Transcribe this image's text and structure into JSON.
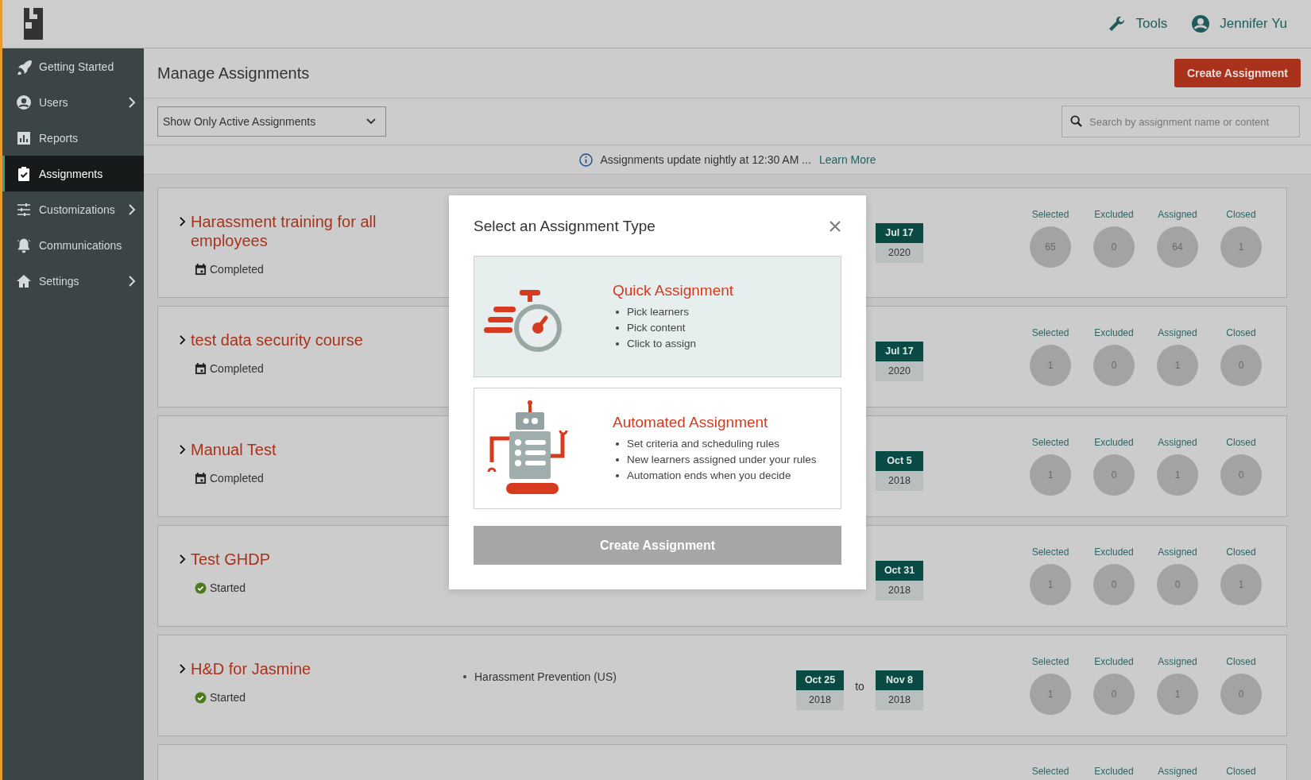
{
  "header": {
    "tools": "Tools",
    "user": "Jennifer Yu"
  },
  "sidebar": {
    "items": [
      {
        "label": "Getting Started",
        "expandable": false,
        "selected": false
      },
      {
        "label": "Users",
        "expandable": true,
        "selected": false
      },
      {
        "label": "Reports",
        "expandable": false,
        "selected": false
      },
      {
        "label": "Assignments",
        "expandable": false,
        "selected": true
      },
      {
        "label": "Customizations",
        "expandable": true,
        "selected": false
      },
      {
        "label": "Communications",
        "expandable": false,
        "selected": false
      },
      {
        "label": "Settings",
        "expandable": true,
        "selected": false
      }
    ]
  },
  "page": {
    "title": "Manage Assignments",
    "create_button": "Create Assignment",
    "filter": {
      "value": "Show Only Active Assignments"
    },
    "search": {
      "placeholder": "Search by assignment name or content"
    },
    "notice": {
      "text": "Assignments update nightly at 12:30 AM ...",
      "link": "Learn More"
    }
  },
  "assignments": [
    {
      "title": "Harassment training for all employees",
      "status": "Completed",
      "kind": "completed",
      "end_date": {
        "day": "Jul 17",
        "year": "2020"
      },
      "stats": [
        {
          "label": "Selected",
          "value": "65"
        },
        {
          "label": "Excluded",
          "value": "0"
        },
        {
          "label": "Assigned",
          "value": "64"
        },
        {
          "label": "Closed",
          "value": "1"
        }
      ]
    },
    {
      "title": "test data security course",
      "status": "Completed",
      "kind": "completed",
      "end_date": {
        "day": "Jul 17",
        "year": "2020"
      },
      "stats": [
        {
          "label": "Selected",
          "value": "1"
        },
        {
          "label": "Excluded",
          "value": "0"
        },
        {
          "label": "Assigned",
          "value": "1"
        },
        {
          "label": "Closed",
          "value": "0"
        }
      ]
    },
    {
      "title": "Manual Test",
      "status": "Completed",
      "kind": "completed",
      "end_date": {
        "day": "Oct 5",
        "year": "2018"
      },
      "stats": [
        {
          "label": "Selected",
          "value": "1"
        },
        {
          "label": "Excluded",
          "value": "0"
        },
        {
          "label": "Assigned",
          "value": "1"
        },
        {
          "label": "Closed",
          "value": "0"
        }
      ]
    },
    {
      "title": "Test GHDP",
      "status": "Started",
      "kind": "started",
      "end_date": {
        "day": "Oct 31",
        "year": "2018"
      },
      "stats": [
        {
          "label": "Selected",
          "value": "1"
        },
        {
          "label": "Excluded",
          "value": "0"
        },
        {
          "label": "Assigned",
          "value": "0"
        },
        {
          "label": "Closed",
          "value": "1"
        }
      ]
    },
    {
      "title": "H&D for Jasmine",
      "status": "Started",
      "kind": "started",
      "content": [
        "Harassment Prevention (US)"
      ],
      "start_date": {
        "day": "Oct 25",
        "year": "2018"
      },
      "date_separator": "to",
      "end_date": {
        "day": "Nov 8",
        "year": "2018"
      },
      "stats": [
        {
          "label": "Selected",
          "value": "1"
        },
        {
          "label": "Excluded",
          "value": "0"
        },
        {
          "label": "Assigned",
          "value": "1"
        },
        {
          "label": "Closed",
          "value": "0"
        }
      ]
    },
    {
      "stats": [
        {
          "label": "Selected"
        },
        {
          "label": "Excluded"
        },
        {
          "label": "Assigned"
        },
        {
          "label": "Closed"
        }
      ]
    }
  ],
  "modal": {
    "title": "Select an Assignment Type",
    "options": [
      {
        "kind": "quick",
        "title": "Quick Assignment",
        "highlighted": true,
        "bullets": [
          "Pick learners",
          "Pick content",
          "Click to assign"
        ]
      },
      {
        "kind": "automated",
        "title": "Automated Assignment",
        "highlighted": false,
        "bullets": [
          "Set criteria and scheduling rules",
          "New learners assigned under your rules",
          "Automation ends when you decide"
        ]
      }
    ],
    "button": {
      "label": "Create Assignment",
      "disabled": true
    }
  }
}
